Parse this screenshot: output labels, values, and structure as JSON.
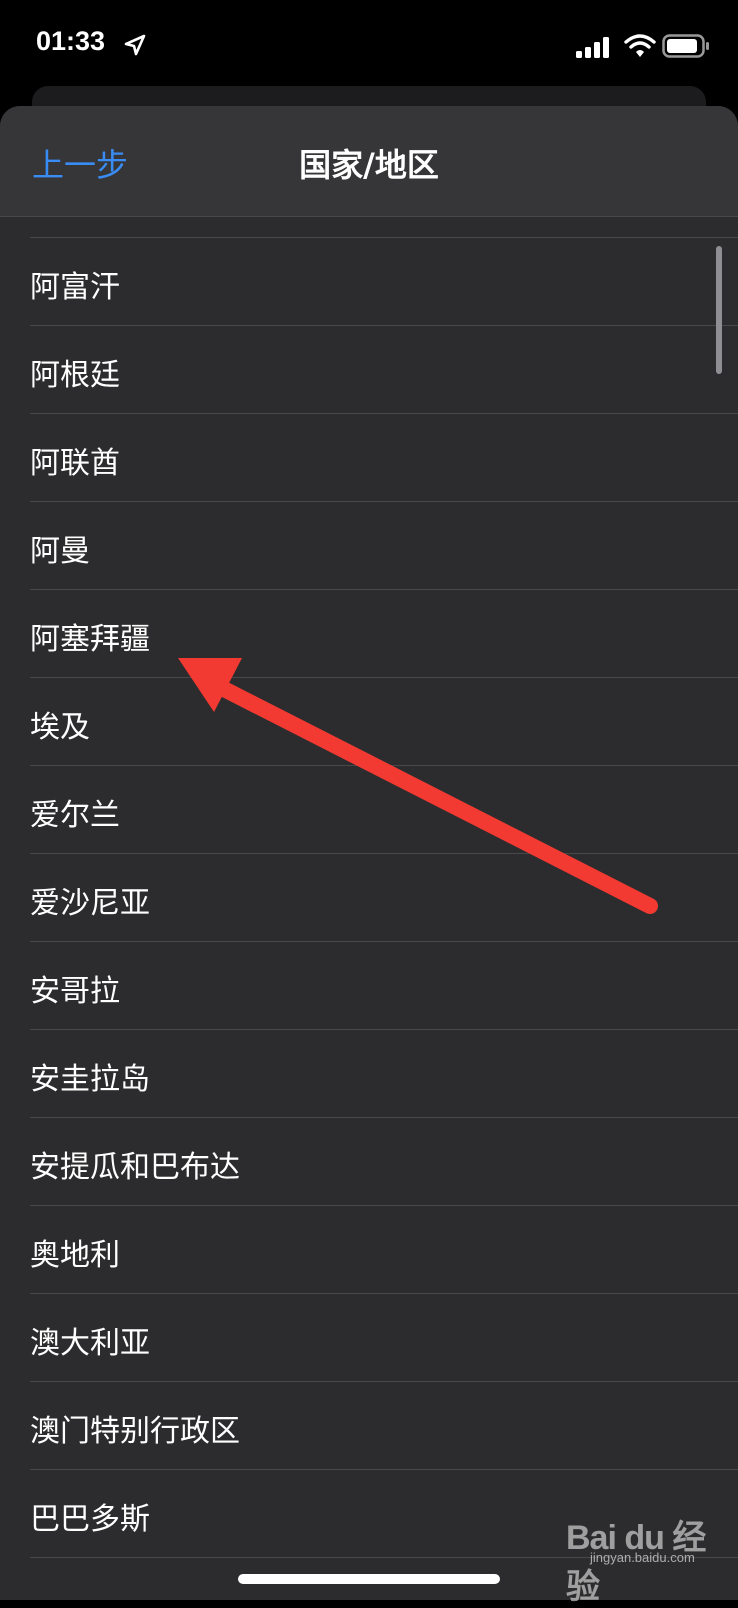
{
  "status_bar": {
    "time": "01:33",
    "icons": [
      "location-arrow-icon",
      "signal-bars-icon",
      "wifi-icon",
      "battery-icon"
    ]
  },
  "nav": {
    "back_label": "上一步",
    "title": "国家/地区"
  },
  "list": {
    "items": [
      "阿富汗",
      "阿根廷",
      "阿联酋",
      "阿曼",
      "阿塞拜疆",
      "埃及",
      "爱尔兰",
      "爱沙尼亚",
      "安哥拉",
      "安圭拉岛",
      "安提瓜和巴布达",
      "奥地利",
      "澳大利亚",
      "澳门特别行政区",
      "巴巴多斯"
    ]
  },
  "watermark": {
    "brand": "Bai du 经验",
    "url": "jingyan.baidu.com"
  },
  "colors": {
    "background": "#000000",
    "sheet": "#2c2c2e",
    "nav_bar": "#363638",
    "separator": "#48484a",
    "accent": "#3a8cf5",
    "annotation": "#f23a32"
  }
}
